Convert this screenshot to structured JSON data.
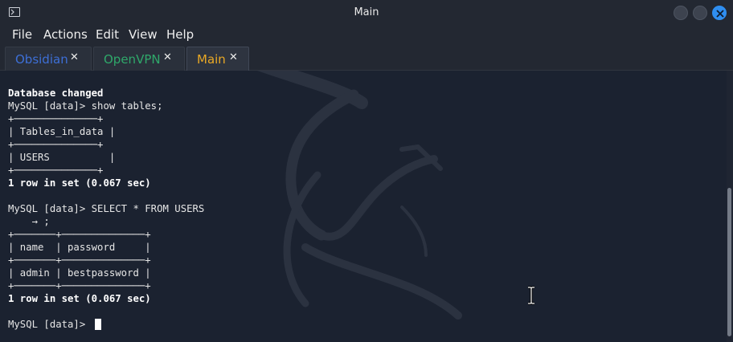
{
  "window": {
    "title": "Main",
    "icon": "terminal-icon"
  },
  "menu": {
    "items": [
      "File",
      "Actions",
      "Edit",
      "View",
      "Help"
    ]
  },
  "tabs": [
    {
      "label": "Obsidian",
      "color": "#3d6fd6"
    },
    {
      "label": "OpenVPN",
      "color": "#2fa86a"
    },
    {
      "label": "Main",
      "color": "#e9a825"
    }
  ],
  "terminal": {
    "lines": [
      "Database changed",
      "MySQL [data]> show tables;",
      "+──────────────+",
      "| Tables_in_data |",
      "+──────────────+",
      "| USERS          |",
      "+──────────────+",
      "1 row in set (0.067 sec)",
      "",
      "MySQL [data]> SELECT * FROM USERS",
      "    → ;",
      "+───────+──────────────+",
      "| name  | password     |",
      "+───────+──────────────+",
      "| admin | bestpassword |",
      "+───────+──────────────+",
      "1 row in set (0.067 sec)",
      "",
      "MySQL [data]> "
    ]
  },
  "colors": {
    "background": "#1b2230",
    "chrome": "#232832",
    "close_button": "#2f8ef0"
  }
}
